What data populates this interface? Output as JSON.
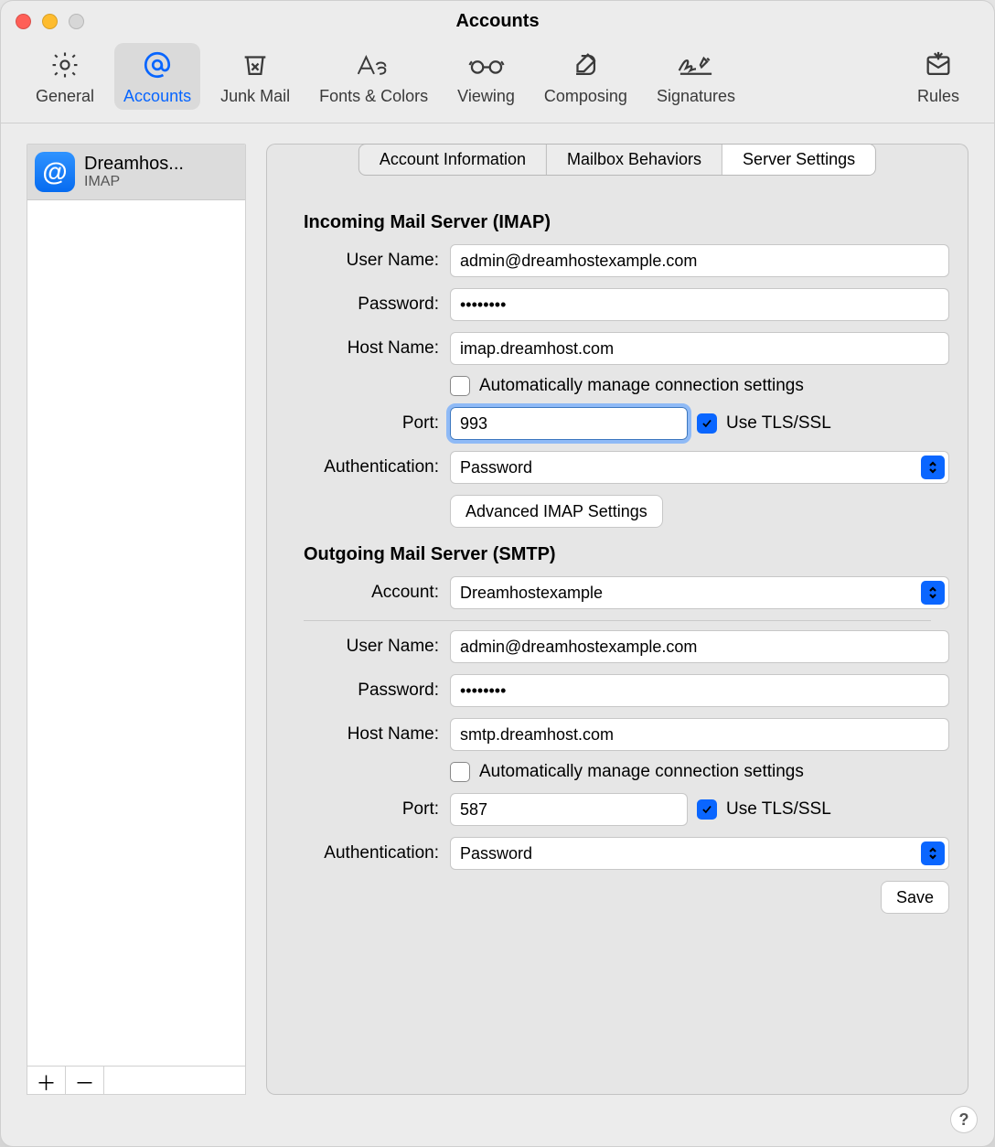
{
  "window": {
    "title": "Accounts"
  },
  "toolbar": {
    "items": [
      {
        "label": "General"
      },
      {
        "label": "Accounts"
      },
      {
        "label": "Junk Mail"
      },
      {
        "label": "Fonts & Colors"
      },
      {
        "label": "Viewing"
      },
      {
        "label": "Composing"
      },
      {
        "label": "Signatures"
      },
      {
        "label": "Rules"
      }
    ]
  },
  "sidebar": {
    "accounts": [
      {
        "name": "Dreamhos...",
        "type": "IMAP"
      }
    ]
  },
  "tabs": {
    "items": [
      {
        "label": "Account Information"
      },
      {
        "label": "Mailbox Behaviors"
      },
      {
        "label": "Server Settings"
      }
    ]
  },
  "form": {
    "incoming": {
      "heading": "Incoming Mail Server (IMAP)",
      "username_label": "User Name:",
      "username": "admin@dreamhostexample.com",
      "password_label": "Password:",
      "password": "••••••••",
      "host_label": "Host Name:",
      "host": "imap.dreamhost.com",
      "auto_label": "Automatically manage connection settings",
      "port_label": "Port:",
      "port": "993",
      "tls_label": "Use TLS/SSL",
      "auth_label": "Authentication:",
      "auth": "Password",
      "advanced_btn": "Advanced IMAP Settings"
    },
    "outgoing": {
      "heading": "Outgoing Mail Server (SMTP)",
      "account_label": "Account:",
      "account": "Dreamhostexample",
      "username_label": "User Name:",
      "username": "admin@dreamhostexample.com",
      "password_label": "Password:",
      "password": "••••••••",
      "host_label": "Host Name:",
      "host": "smtp.dreamhost.com",
      "auto_label": "Automatically manage connection settings",
      "port_label": "Port:",
      "port": "587",
      "tls_label": "Use TLS/SSL",
      "auth_label": "Authentication:",
      "auth": "Password"
    },
    "save_btn": "Save"
  }
}
